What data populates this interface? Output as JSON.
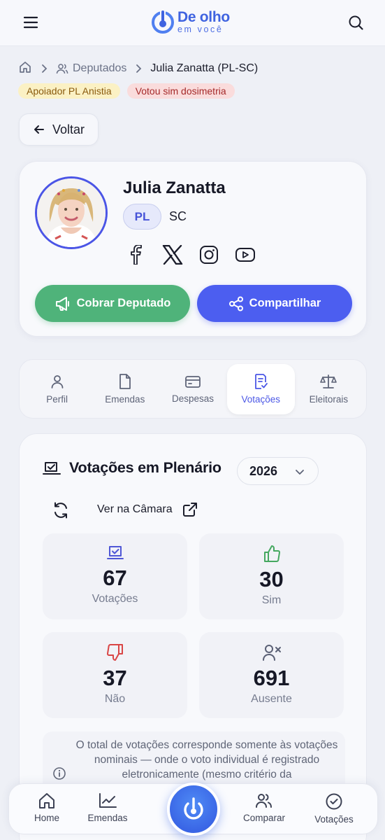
{
  "header": {
    "logo_title": "De olho",
    "logo_subtitle": "em você"
  },
  "breadcrumb": {
    "section": "Deputados",
    "current": "Julia Zanatta (PL-SC)"
  },
  "tags": [
    "Apoiador PL Anistia",
    "Votou sim dosimetria"
  ],
  "back_label": "Voltar",
  "profile": {
    "name": "Julia Zanatta",
    "party": "PL",
    "state": "SC",
    "socials": [
      "facebook-icon",
      "x-icon",
      "instagram-icon",
      "youtube-icon"
    ],
    "cobrar_label": "Cobrar Deputado",
    "share_label": "Compartilhar"
  },
  "tabs": [
    {
      "label": "Perfil",
      "icon": "user-icon",
      "active": false
    },
    {
      "label": "Emendas",
      "icon": "document-icon",
      "active": false
    },
    {
      "label": "Despesas",
      "icon": "wallet-icon",
      "active": false
    },
    {
      "label": "Votações",
      "icon": "checklist-icon",
      "active": true
    },
    {
      "label": "Eleitorais",
      "icon": "scale-icon",
      "active": false
    }
  ],
  "votes": {
    "title": "Votações em Plenário",
    "year": "2026",
    "camara_link": "Ver na Câmara",
    "stats": [
      {
        "value": "67",
        "label": "Votações",
        "icon": "ballot-icon",
        "color": "#4f57d6"
      },
      {
        "value": "30",
        "label": "Sim",
        "icon": "thumbs-up-icon",
        "color": "#45a860"
      },
      {
        "value": "37",
        "label": "Não",
        "icon": "thumbs-down-icon",
        "color": "#d94545"
      },
      {
        "value": "691",
        "label": "Ausente",
        "icon": "user-x-icon",
        "color": "#5a6075"
      }
    ],
    "note": "O total de votações corresponde somente às votações nominais — onde o voto individual é registrado eletronicamente (mesmo critério da"
  },
  "bottom_nav": [
    {
      "label": "Home",
      "icon": "home-icon"
    },
    {
      "label": "Emendas",
      "icon": "chart-line-icon"
    },
    {
      "label": "Comparar",
      "icon": "users-icon"
    },
    {
      "label": "Votações",
      "icon": "check-circle-icon"
    }
  ],
  "colors": {
    "accent": "#4c5ef0",
    "green": "#4fb37a",
    "brand": "#3f63e0"
  }
}
